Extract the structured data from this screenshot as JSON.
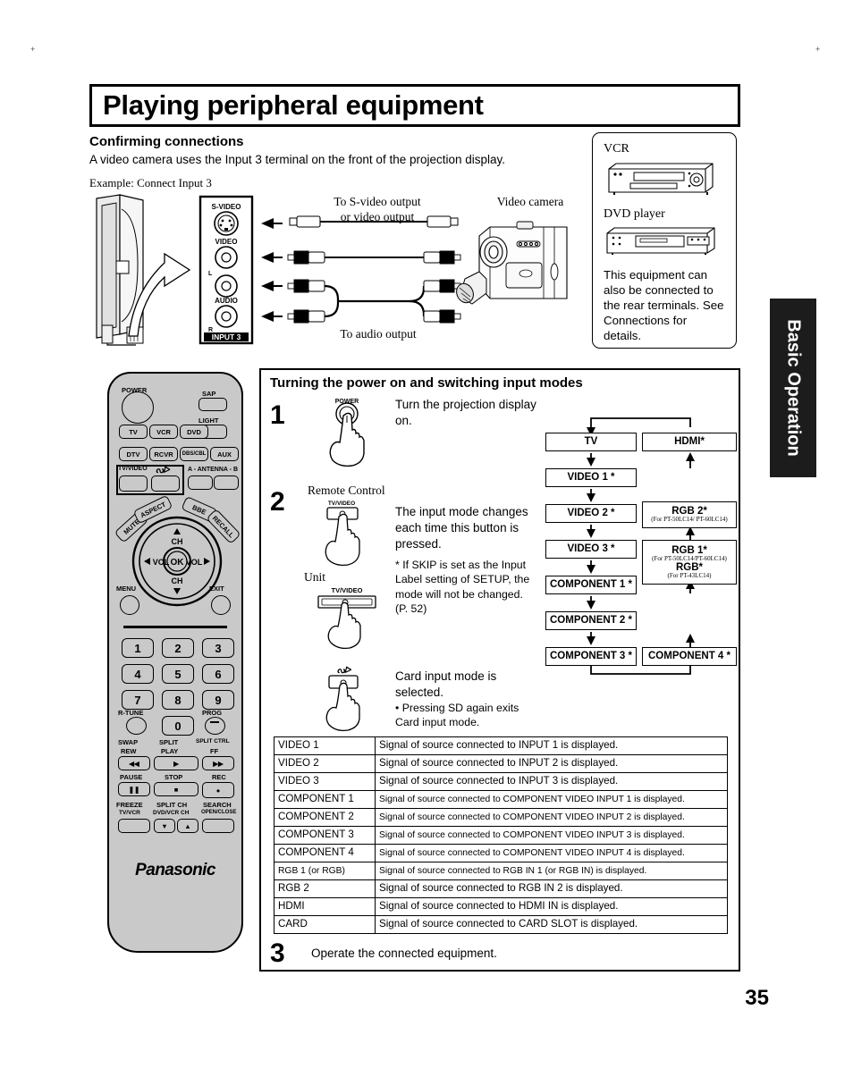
{
  "page": {
    "title": "Playing peripheral equipment",
    "number": "35",
    "side_tab": "Basic Operation"
  },
  "section1": {
    "heading": "Confirming connections",
    "paragraph": "A video camera uses the Input 3 terminal on the front of the projection display.",
    "example": "Example: Connect Input 3",
    "panel_jacks": [
      "S-VIDEO",
      "VIDEO",
      "L",
      "AUDIO",
      "R"
    ],
    "panel_name": "INPUT 3",
    "cable_label_top": "To S-video output",
    "cable_label_top2": "or video output",
    "cable_label_bottom": "To audio output",
    "camera_label": "Video camera"
  },
  "equipment_box": {
    "vcr_label": "VCR",
    "dvd_label": "DVD player",
    "note": "This equipment can also be connected to the rear terminals. See Connections for details."
  },
  "remote": {
    "power": "POWER",
    "sap": "SAP",
    "light": "LIGHT",
    "row1": [
      "TV",
      "VCR",
      "DVD"
    ],
    "row2": [
      "DTV",
      "RCVR",
      "DBS/CBL",
      "AUX"
    ],
    "tv_video": "TV/VIDEO",
    "sd": "SD",
    "antenna": "A - ANTENNA - B",
    "mute": "MUTE",
    "aspect": "ASPECT",
    "bbe": "BBE",
    "recall": "RECALL",
    "ch_up": "CH",
    "ch_down": "CH",
    "vol_left": "VOL",
    "vol_right": "VOL",
    "ok": "OK",
    "menu": "MENU",
    "exit": "EXIT",
    "numbers": [
      "1",
      "2",
      "3",
      "4",
      "5",
      "6",
      "7",
      "8",
      "9",
      "0"
    ],
    "r_tune": "R-TUNE",
    "prog": "PROG",
    "swap": "SWAP",
    "rew": "REW",
    "split": "SPLIT",
    "play": "PLAY",
    "split_ctrl": "SPLIT CTRL",
    "ff": "FF",
    "pause": "PAUSE",
    "stop": "STOP",
    "rec": "REC",
    "freeze": "FREEZE",
    "freeze_sub": "TV/VCR",
    "split_ch": "SPLIT CH",
    "split_ch_sub": "DVD/VCR CH",
    "search": "SEARCH",
    "search_sub": "OPEN/CLOSE",
    "brand": "Panasonic"
  },
  "section2": {
    "heading": "Turning the power on and switching input modes",
    "step1": {
      "num": "1",
      "button": "POWER",
      "text": "Turn the projection display on."
    },
    "step2": {
      "num": "2",
      "remote_label": "Remote Control",
      "remote_button": "TV/VIDEO",
      "unit_label": "Unit",
      "unit_button": "TV/VIDEO",
      "text": "The input mode changes each time this button is pressed.",
      "note": "*  If SKIP is set as the Input Label setting of SETUP, the mode will not be changed. (P. 52)",
      "sd_button": "SD",
      "sd_text": "Card input mode is selected.",
      "sd_note": "•  Pressing SD again exits Card input mode."
    },
    "step3": {
      "num": "3",
      "text": "Operate the connected equipment."
    }
  },
  "flowchart": {
    "left_column": [
      "TV",
      "VIDEO 1 *",
      "VIDEO 2 *",
      "VIDEO 3 *",
      "COMPONENT 1 *",
      "COMPONENT 2 *",
      "COMPONENT 3 *"
    ],
    "right_column": [
      {
        "main": "HDMI*",
        "sub": ""
      },
      {
        "main": "RGB 2*",
        "sub": "(For PT-50LC14/ PT-60LC14)"
      },
      {
        "main": "RGB 1*",
        "sub": "(For PT-50LC14/PT-60LC14)",
        "main2": "RGB*",
        "sub2": "(For PT-43LC14)"
      },
      {
        "main": "COMPONENT 4 *",
        "sub": ""
      }
    ]
  },
  "table": {
    "rows": [
      {
        "mode": "VIDEO 1",
        "desc": "Signal of source connected to INPUT 1 is displayed.",
        "small": false
      },
      {
        "mode": "VIDEO 2",
        "desc": "Signal of source connected to INPUT 2 is displayed.",
        "small": false
      },
      {
        "mode": "VIDEO 3",
        "desc": "Signal of source connected to INPUT 3 is displayed.",
        "small": false
      },
      {
        "mode": "COMPONENT 1",
        "desc": "Signal of source connected to COMPONENT VIDEO INPUT 1 is displayed.",
        "small": true
      },
      {
        "mode": "COMPONENT 2",
        "desc": "Signal of source connected to COMPONENT VIDEO INPUT 2 is displayed.",
        "small": true
      },
      {
        "mode": "COMPONENT 3",
        "desc": "Signal of source connected to COMPONENT VIDEO INPUT 3 is displayed.",
        "small": true
      },
      {
        "mode": "COMPONENT 4",
        "desc": "Signal of source connected to COMPONENT VIDEO INPUT 4 is displayed.",
        "small": true
      },
      {
        "mode": "RGB 1 (or RGB)",
        "desc": "Signal of source connected to RGB IN 1 (or RGB IN) is displayed.",
        "small": true
      },
      {
        "mode": "RGB 2",
        "desc": "Signal of source connected to RGB IN 2  is displayed.",
        "small": false
      },
      {
        "mode": "HDMI",
        "desc": "Signal of source connected to HDMI IN is displayed.",
        "small": false
      },
      {
        "mode": "CARD",
        "desc": "Signal of source connected to CARD SLOT is displayed.",
        "small": false
      }
    ]
  }
}
